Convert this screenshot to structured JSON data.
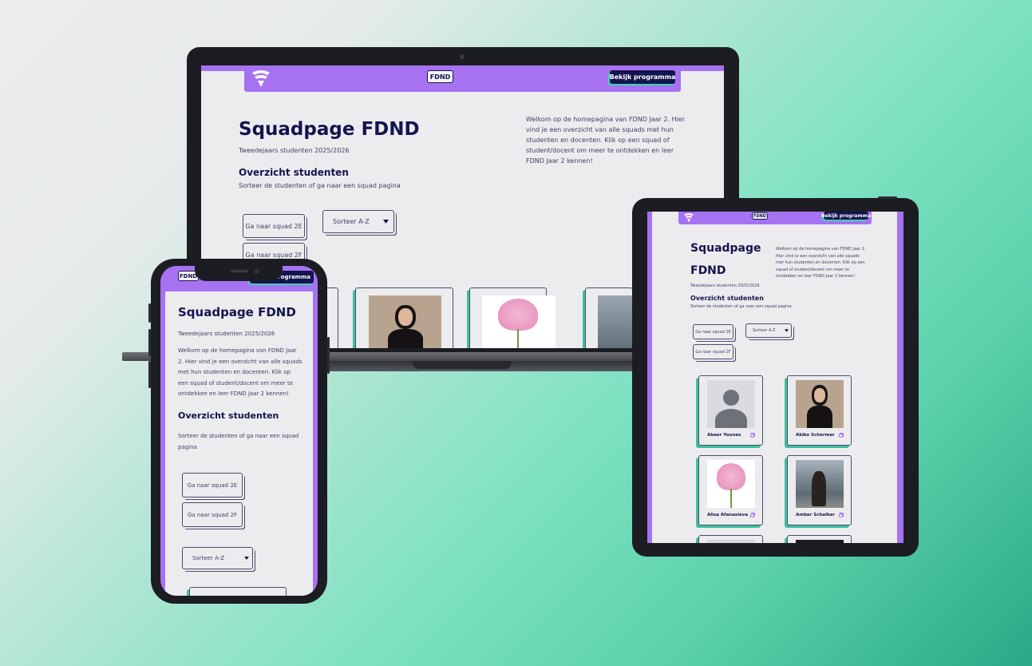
{
  "site": {
    "header_pill": "FDND",
    "program_button": "Bekijk programma",
    "title": "Squadpage FDND",
    "subtitle": "Tweedejaars studenten 2025/2026",
    "intro": "Welkom op de homepagina van FDND Jaar 2. Hier vind je een overzicht van alle squads met hun studenten en docenten. Klik op een squad of student/docent om meer te ontdekken en leer FDND Jaar 2 kennen!",
    "overview_heading": "Overzicht studenten",
    "overview_sub": "Sorteer de studenten of ga naar een squad pagina",
    "squad_2e": "Ga naar squad 2E",
    "squad_2f": "Ga naar squad 2F",
    "sort_select": "Sorteer A-Z"
  },
  "tablet": {
    "title_line1": "Squadpage",
    "title_line2": "FDND"
  },
  "students": [
    {
      "name": "Abeer Younes"
    },
    {
      "name": "Akiko Schermer"
    },
    {
      "name": "Alisa Afanasieva"
    },
    {
      "name": "Amber Schalker"
    }
  ],
  "colors": {
    "accent": "#a772f2",
    "navy": "#13144f",
    "teal": "#3fd1b0",
    "page": "#ececee"
  }
}
